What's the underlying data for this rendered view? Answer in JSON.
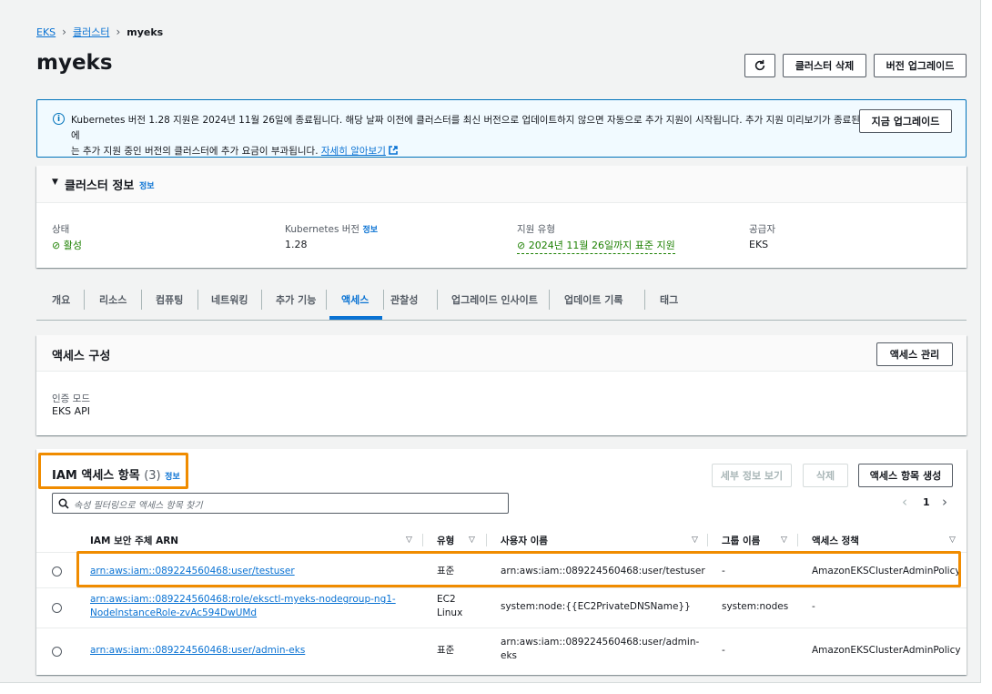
{
  "breadcrumb": {
    "root": "EKS",
    "clusters": "클러스터",
    "current": "myeks"
  },
  "page": {
    "title": "myeks"
  },
  "header_buttons": {
    "refresh_icon": "refresh-icon",
    "delete": "클러스터 삭제",
    "upgrade": "버전 업그레이드"
  },
  "alert": {
    "text_line1": "Kubernetes 버전 1.28 지원은 2024년 11월 26일에 종료됩니다. 해당 날짜 이전에 클러스터를 최신 버전으로 업데이트하지 않으면 자동으로 추가 지원이 시작됩니다. 추가 지원 미리보기가 종료된 후에",
    "text_line2": "는 추가 지원 중인 버전의 클러스터에 추가 요금이 부과됩니다.",
    "link": "자세히 알아보기",
    "button": "지금 업그레이드"
  },
  "cluster_info": {
    "heading": "클러스터 정보",
    "info": "정보",
    "status_label": "상태",
    "status_value": "활성",
    "k8s_label": "Kubernetes 버전",
    "k8s_info": "정보",
    "k8s_value": "1.28",
    "support_label": "지원 유형",
    "support_value": "2024년 11월 26일까지 표준 지원",
    "provider_label": "공급자",
    "provider_value": "EKS"
  },
  "tabs": [
    "개요",
    "리소스",
    "컴퓨팅",
    "네트워킹",
    "추가 기능",
    "액세스",
    "관찰성",
    "업그레이드 인사이트",
    "업데이트 기록",
    "태그"
  ],
  "active_tab": "액세스",
  "access_config": {
    "heading": "액세스 구성",
    "manage_button": "액세스 관리",
    "auth_label": "인증 모드",
    "auth_value": "EKS API"
  },
  "iam_entries": {
    "heading": "IAM 액세스 항목",
    "count": "(3)",
    "info": "정보",
    "btn_details": "세부 정보 보기",
    "btn_delete": "삭제",
    "btn_create": "액세스 항목 생성",
    "search_placeholder": "속성 필터링으로 액세스 항목 찾기",
    "page": "1",
    "columns": [
      "IAM 보안 주체 ARN",
      "유형",
      "사용자 이름",
      "그룹 이름",
      "액세스 정책"
    ],
    "rows": [
      {
        "arn": "arn:aws:iam::089224560468:user/testuser",
        "type": "표준",
        "username": "arn:aws:iam::089224560468:user/testuser",
        "group": "-",
        "policy": "AmazonEKSClusterAdminPolicy"
      },
      {
        "arn_l1": "arn:aws:iam::089224560468:role/eksctl-myeks-nodegroup-ng1-",
        "arn_l2": "NodeInstanceRole-zvAc594DwUMd",
        "type_l1": "EC2",
        "type_l2": "Linux",
        "username": "system:node:{{EC2PrivateDNSName}}",
        "group": "system:nodes",
        "policy": "-"
      },
      {
        "arn": "arn:aws:iam::089224560468:user/admin-eks",
        "type": "표준",
        "username_l1": "arn:aws:iam::089224560468:user/admin-",
        "username_l2": "eks",
        "group": "-",
        "policy": "AmazonEKSClusterAdminPolicy"
      }
    ]
  },
  "colors": {
    "link": "#0972d3",
    "success": "#1d8102",
    "highlight": "#f08c00",
    "alert_border": "#0073bb"
  }
}
